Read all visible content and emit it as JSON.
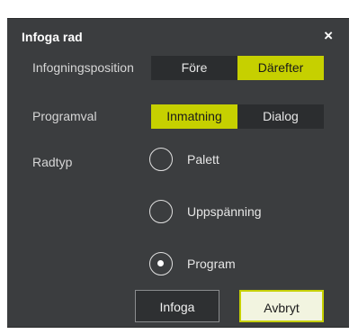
{
  "dialog": {
    "title": "Infoga rad",
    "close_symbol": "×"
  },
  "insert_position": {
    "label": "Infogningsposition",
    "options": [
      "Före",
      "Därefter"
    ],
    "selected": "Därefter"
  },
  "program_choice": {
    "label": "Programval",
    "options": [
      "Inmatning",
      "Dialog"
    ],
    "selected": "Inmatning"
  },
  "row_type": {
    "label": "Radtyp",
    "options": [
      "Palett",
      "Uppspänning",
      "Program"
    ],
    "selected": "Program"
  },
  "buttons": {
    "insert": "Infoga",
    "cancel": "Avbryt"
  },
  "colors": {
    "accent": "#c6d000",
    "dialog_bg": "#3b3d3f",
    "segment_off_bg": "#2b2d2f"
  },
  "icons": {
    "close": "close-icon",
    "radio_unchecked": "radio-unchecked-icon",
    "radio_checked": "radio-checked-icon"
  }
}
